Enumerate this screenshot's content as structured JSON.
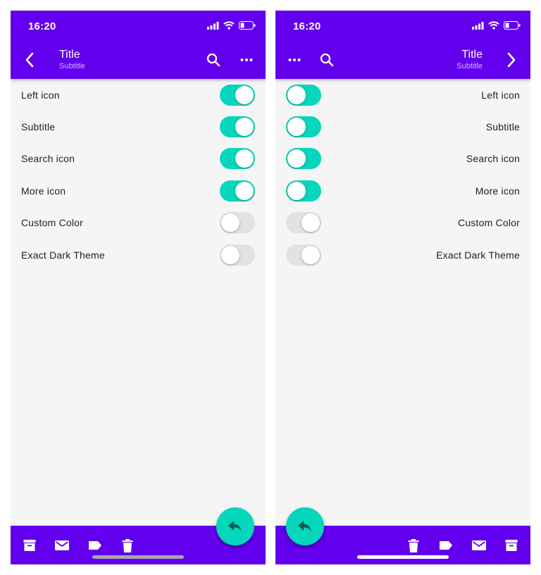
{
  "colors": {
    "primary": "#6200ee",
    "accent": "#04d7bb",
    "background": "#f5f5f5",
    "switch_off": "#e2e2e2"
  },
  "status_bar": {
    "time": "16:20"
  },
  "app_bar": {
    "title": "Title",
    "subtitle": "Subtitle"
  },
  "settings": [
    {
      "label": "Left icon",
      "on": true
    },
    {
      "label": "Subtitle",
      "on": true
    },
    {
      "label": "Search icon",
      "on": true
    },
    {
      "label": "More icon",
      "on": true
    },
    {
      "label": "Custom Color",
      "on": false
    },
    {
      "label": "Exact Dark Theme",
      "on": false
    }
  ],
  "icons": {
    "app_bar_left": [
      "chevron-left-icon",
      "search-icon",
      "more-horizontal-icon"
    ],
    "app_bar_right": [
      "more-horizontal-icon",
      "search-icon",
      "chevron-right-icon"
    ],
    "bottom_bar": [
      "archive-icon",
      "mail-icon",
      "label-icon",
      "delete-icon"
    ],
    "fab": "reply-icon"
  }
}
